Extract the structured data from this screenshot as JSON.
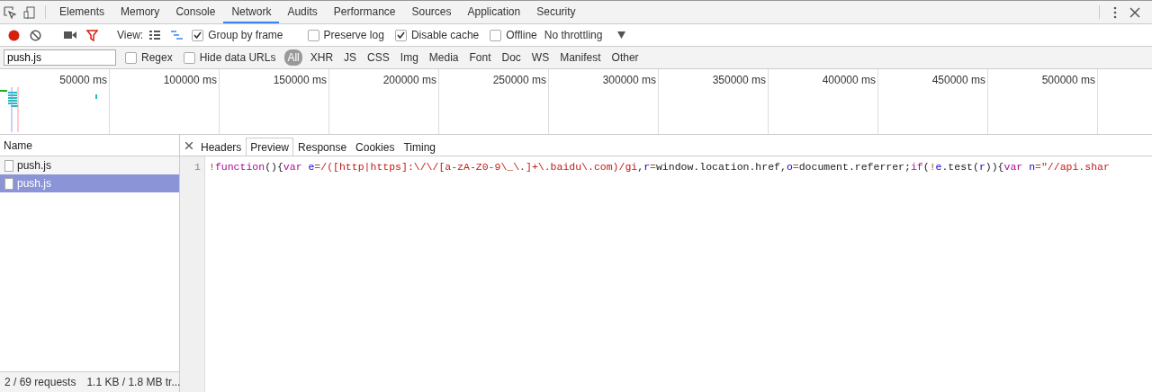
{
  "panel_tabs": [
    {
      "label": "Elements",
      "selected": false
    },
    {
      "label": "Memory",
      "selected": false
    },
    {
      "label": "Console",
      "selected": false
    },
    {
      "label": "Network",
      "selected": true
    },
    {
      "label": "Audits",
      "selected": false
    },
    {
      "label": "Performance",
      "selected": false
    },
    {
      "label": "Sources",
      "selected": false
    },
    {
      "label": "Application",
      "selected": false
    },
    {
      "label": "Security",
      "selected": false
    }
  ],
  "toolbar": {
    "view_label": "View:",
    "options": [
      {
        "label": "Group by frame",
        "checked": true
      },
      {
        "label": "Preserve log",
        "checked": false
      },
      {
        "label": "Disable cache",
        "checked": true
      },
      {
        "label": "Offline",
        "checked": false
      }
    ],
    "throttling": "No throttling"
  },
  "filter": {
    "value": "push.js",
    "options": [
      {
        "label": "Regex",
        "checked": false
      },
      {
        "label": "Hide data URLs",
        "checked": false
      }
    ],
    "types": [
      {
        "label": "All",
        "selected": true
      },
      {
        "label": "XHR",
        "selected": false
      },
      {
        "label": "JS",
        "selected": false
      },
      {
        "label": "CSS",
        "selected": false
      },
      {
        "label": "Img",
        "selected": false
      },
      {
        "label": "Media",
        "selected": false
      },
      {
        "label": "Font",
        "selected": false
      },
      {
        "label": "Doc",
        "selected": false
      },
      {
        "label": "WS",
        "selected": false
      },
      {
        "label": "Manifest",
        "selected": false
      },
      {
        "label": "Other",
        "selected": false
      }
    ]
  },
  "overview": {
    "ticks": [
      "50000 ms",
      "100000 ms",
      "150000 ms",
      "200000 ms",
      "250000 ms",
      "300000 ms",
      "350000 ms",
      "400000 ms",
      "450000 ms",
      "500000 ms"
    ]
  },
  "requests": {
    "column": "Name",
    "rows": [
      {
        "name": "push.js",
        "selected": false
      },
      {
        "name": "push.js",
        "selected": true
      }
    ]
  },
  "detail": {
    "tabs": [
      {
        "label": "Headers",
        "selected": false
      },
      {
        "label": "Preview",
        "selected": true
      },
      {
        "label": "Response",
        "selected": false
      },
      {
        "label": "Cookies",
        "selected": false
      },
      {
        "label": "Timing",
        "selected": false
      }
    ],
    "line_number": "1",
    "code": [
      {
        "kind": "operator",
        "text": "!"
      },
      {
        "kind": "keyword",
        "text": "function"
      },
      {
        "kind": "plain",
        "text": "(){"
      },
      {
        "kind": "keyword",
        "text": "var "
      },
      {
        "kind": "variable",
        "text": "e"
      },
      {
        "kind": "operator",
        "text": "="
      },
      {
        "kind": "string",
        "text": "/([http|https]:\\/\\/[a-zA-Z0-9\\_\\.]+\\.baidu\\.com)/gi"
      },
      {
        "kind": "plain",
        "text": ","
      },
      {
        "kind": "variable",
        "text": "r"
      },
      {
        "kind": "operator",
        "text": "="
      },
      {
        "kind": "plain",
        "text": "window.location.href,"
      },
      {
        "kind": "variable",
        "text": "o"
      },
      {
        "kind": "operator",
        "text": "="
      },
      {
        "kind": "plain",
        "text": "document.referrer;"
      },
      {
        "kind": "keyword",
        "text": "if"
      },
      {
        "kind": "plain",
        "text": "("
      },
      {
        "kind": "operator",
        "text": "!"
      },
      {
        "kind": "variable",
        "text": "e"
      },
      {
        "kind": "plain",
        "text": ".test("
      },
      {
        "kind": "variable",
        "text": "r"
      },
      {
        "kind": "plain",
        "text": ")){"
      },
      {
        "kind": "keyword",
        "text": "var "
      },
      {
        "kind": "variable",
        "text": "n"
      },
      {
        "kind": "operator",
        "text": "="
      },
      {
        "kind": "string",
        "text": "\"//api.shar"
      }
    ]
  },
  "status_bar": {
    "requests": "2 / 69 requests",
    "transferred": "1.1 KB / 1.8 MB tr..."
  }
}
